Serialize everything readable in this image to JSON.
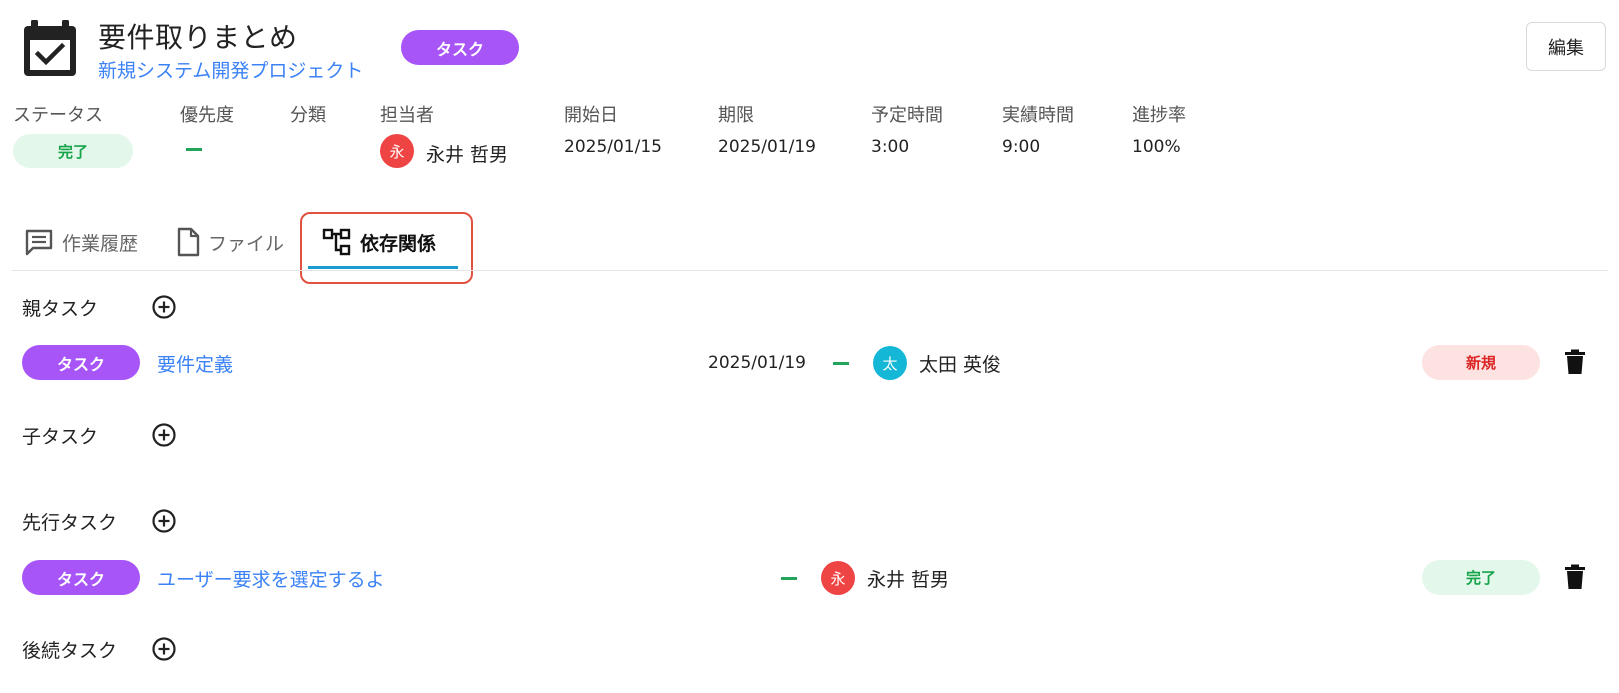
{
  "header": {
    "title": "要件取りまとめ",
    "project": "新規システム開発プロジェクト",
    "type_badge": "タスク",
    "edit_label": "編集"
  },
  "meta": {
    "status": {
      "label": "ステータス",
      "value": "完了"
    },
    "priority": {
      "label": "優先度",
      "value": ""
    },
    "category": {
      "label": "分類",
      "value": ""
    },
    "assignee": {
      "label": "担当者",
      "initial": "永",
      "name": "永井 哲男"
    },
    "start": {
      "label": "開始日",
      "value": "2025/01/15"
    },
    "due": {
      "label": "期限",
      "value": "2025/01/19"
    },
    "planned": {
      "label": "予定時間",
      "value": "3:00"
    },
    "actual": {
      "label": "実績時間",
      "value": "9:00"
    },
    "progress": {
      "label": "進捗率",
      "value": "100%"
    }
  },
  "tabs": [
    {
      "label": "作業履歴",
      "icon": "comment-icon"
    },
    {
      "label": "ファイル",
      "icon": "file-icon"
    },
    {
      "label": "依存関係",
      "icon": "hierarchy-icon",
      "active": true
    }
  ],
  "sections": {
    "parent": {
      "label": "親タスク",
      "items": [
        {
          "type": "タスク",
          "name": "要件定義",
          "due": "2025/01/19",
          "initial": "太",
          "assignee": "太田 英俊",
          "status": "新規"
        }
      ]
    },
    "child": {
      "label": "子タスク",
      "items": []
    },
    "predecessor": {
      "label": "先行タスク",
      "items": [
        {
          "type": "タスク",
          "name": "ユーザー要求を選定するよ",
          "due": "",
          "initial": "永",
          "assignee": "永井 哲男",
          "status": "完了"
        }
      ]
    },
    "successor": {
      "label": "後続タスク",
      "items": []
    }
  },
  "colors": {
    "accent_purple": "#a855f7",
    "link_blue": "#3b82f6",
    "done_green": "#16a34a",
    "new_red": "#dc2626",
    "tab_underline": "#1a9bd1",
    "highlight": "#e0513f"
  }
}
